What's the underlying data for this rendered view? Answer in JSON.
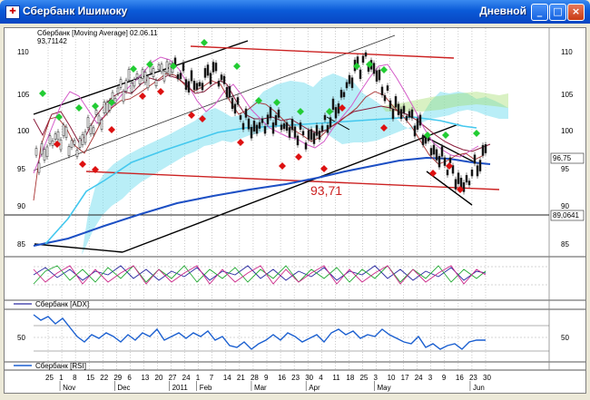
{
  "window": {
    "title": "Сбербанк Ишимоку",
    "period": "Дневной",
    "btn_min": "_",
    "btn_max": "□",
    "btn_close": "×",
    "icon_glyph": "✚"
  },
  "main_panel": {
    "info_line1": "Сбербанк [Moving Average] 02.06.11",
    "info_line2": "93,71142",
    "y_ticks": [
      "110",
      "105",
      "100",
      "95",
      "90",
      "85"
    ],
    "last_price": "96,75",
    "hline_label": "89,0641",
    "annotation": "93,71"
  },
  "adx_panel": {
    "label": "Сбербанк [ADX]"
  },
  "rsi_panel": {
    "label": "Сбербанк [RSI]",
    "y_tick": "50"
  },
  "x_axis": {
    "days": [
      "25",
      "1",
      "8",
      "15",
      "22",
      "29",
      "6",
      "13",
      "20",
      "27",
      "24",
      "1",
      "7",
      "14",
      "21",
      "28",
      "9",
      "16",
      "23",
      "30",
      "4",
      "11",
      "18",
      "25",
      "3",
      "10",
      "17",
      "24",
      "3",
      "9",
      "16",
      "23",
      "30"
    ],
    "months": [
      "Nov",
      "Dec",
      "2011",
      "Feb",
      "Mar",
      "Apr",
      "May",
      "Jun"
    ]
  },
  "colors": {
    "accent_red": "#cc2222",
    "ma_blue": "#1c4fc4",
    "cloud_cyan": "#4fd6ee",
    "signal_green": "#22cc33",
    "signal_red": "#dd1111",
    "rsi_blue": "#1a5fd0"
  }
}
